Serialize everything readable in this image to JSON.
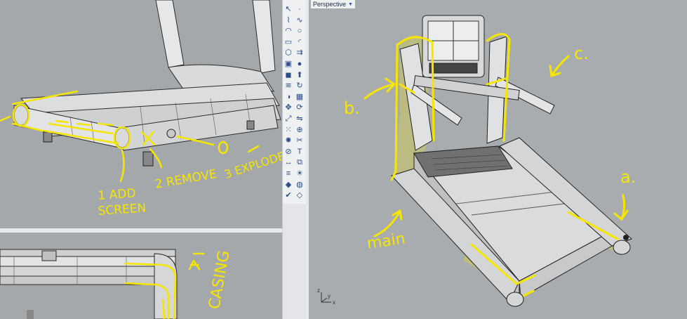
{
  "viewport_perspective": {
    "title": "Perspective"
  },
  "annotations_top": {
    "step1": "1 ADD",
    "step1b": "SCREEN",
    "step2": "2 REMOVE",
    "step3": "3 EXPLODE",
    "zero": "0"
  },
  "annotations_bottom": {
    "casing": "CASING"
  },
  "annotations_persp": {
    "a": "a.",
    "b": "b.",
    "c": "c.",
    "main": "main"
  },
  "axes": {
    "x": "x",
    "y": "y",
    "z": "z"
  },
  "colors": {
    "highlight": "#f5e600",
    "viewport_bg": "#a9acae",
    "toolbar_bg": "#eef0f2"
  },
  "toolbar_icons": [
    "select-icon",
    "point-icon",
    "polyline-icon",
    "curve-icon",
    "arc-icon",
    "circle-icon",
    "rectangle-icon",
    "fillet-icon",
    "polygon-icon",
    "offset-icon",
    "box-icon",
    "sphere-icon",
    "cylinder-icon",
    "extrude-icon",
    "loft-icon",
    "revolve-icon",
    "boolean-icon",
    "mesh-icon",
    "move-icon",
    "rotate-icon",
    "scale-icon",
    "mirror-icon",
    "array-icon",
    "join-icon",
    "explode-icon",
    "trim-icon",
    "split-icon",
    "text-icon",
    "dimension-icon",
    "group-icon",
    "layer-icon",
    "render-icon",
    "light-icon",
    "material-icon",
    "check-icon",
    "analysis-icon"
  ]
}
